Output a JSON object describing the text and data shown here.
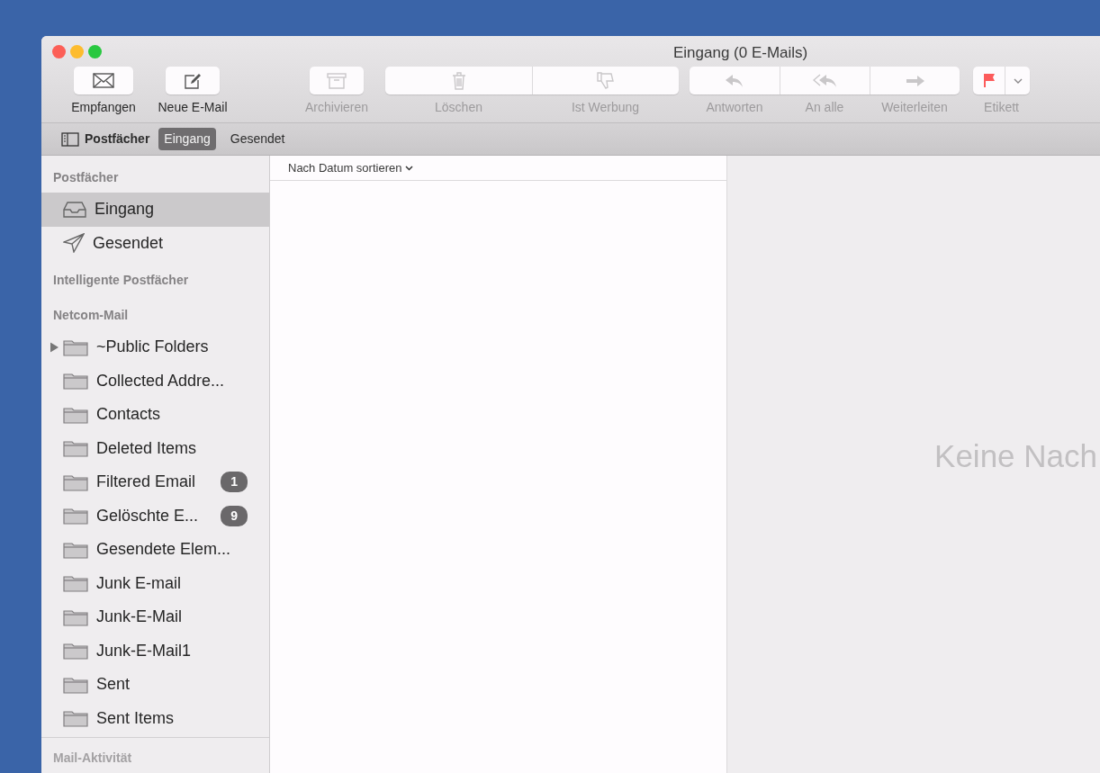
{
  "window": {
    "title": "Eingang (0 E-Mails)"
  },
  "toolbar": [
    {
      "kind": "button",
      "items": [
        {
          "kind": "get-mail",
          "label": "Empfangen",
          "disabled": false
        }
      ]
    },
    {
      "kind": "button",
      "items": [
        {
          "kind": "compose",
          "label": "Neue E-Mail",
          "disabled": false
        }
      ]
    },
    {
      "kind": "button",
      "items": [
        {
          "kind": "archive",
          "label": "Archivieren",
          "disabled": true
        }
      ]
    },
    {
      "kind": "segmented",
      "items": [
        {
          "kind": "delete",
          "label": "Löschen",
          "disabled": true
        },
        {
          "kind": "junk",
          "label": "Ist Werbung",
          "disabled": true
        }
      ]
    },
    {
      "kind": "segmented",
      "items": [
        {
          "kind": "reply",
          "label": "Antworten",
          "disabled": true
        },
        {
          "kind": "reply-all",
          "label": "An alle",
          "disabled": true
        },
        {
          "kind": "forward",
          "label": "Weiterleiten",
          "disabled": true
        }
      ]
    },
    {
      "kind": "menu",
      "label": "Etikett",
      "disabled": true,
      "items": [
        {
          "kind": "flag",
          "color": "#fc5b5b"
        }
      ]
    }
  ],
  "favorites_bar": {
    "toggle_label": "Postfächer",
    "items": [
      {
        "label": "Eingang",
        "selected": true
      },
      {
        "label": "Gesendet",
        "selected": false
      }
    ]
  },
  "sidebar": {
    "sections": [
      {
        "title": "Postfächer",
        "items": [
          {
            "kind": "inbox",
            "label": "Eingang",
            "selected": true
          },
          {
            "kind": "sent",
            "label": "Gesendet",
            "selected": false
          }
        ]
      },
      {
        "title": "Intelligente Postfächer"
      },
      {
        "title": "Netcom-Mail",
        "items": [
          {
            "kind": "folder",
            "label": "~Public Folders",
            "selected": false,
            "expanded": false
          },
          {
            "kind": "folder",
            "label": "Collected Addre...",
            "selected": false
          },
          {
            "kind": "folder",
            "label": "Contacts",
            "selected": false
          },
          {
            "kind": "folder",
            "label": "Deleted Items",
            "selected": false
          },
          {
            "kind": "folder",
            "label": "Filtered Email",
            "selected": false,
            "badge": "1"
          },
          {
            "kind": "folder",
            "label": "Gelöschte E...",
            "selected": false,
            "badge": "9"
          },
          {
            "kind": "folder",
            "label": "Gesendete Elem...",
            "selected": false
          },
          {
            "kind": "folder",
            "label": "Junk E-mail",
            "selected": false
          },
          {
            "kind": "folder",
            "label": "Junk-E-Mail",
            "selected": false
          },
          {
            "kind": "folder",
            "label": "Junk-E-Mail1",
            "selected": false
          },
          {
            "kind": "folder",
            "label": "Sent",
            "selected": false
          },
          {
            "kind": "folder",
            "label": "Sent Items",
            "selected": false
          }
        ]
      }
    ],
    "activity_title": "Mail-Aktivität"
  },
  "message_list": {
    "sort_label": "Nach Datum sortieren"
  },
  "preview": {
    "empty_text": "Keine Nach"
  }
}
